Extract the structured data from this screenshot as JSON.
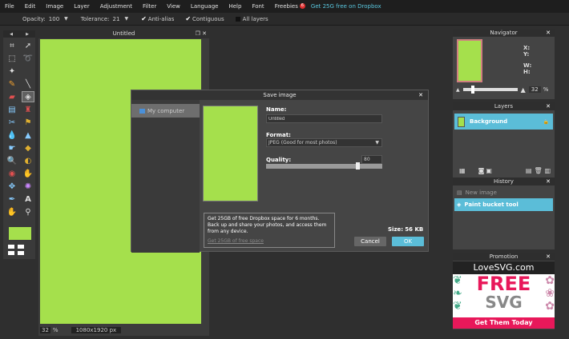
{
  "menu": {
    "items": [
      "File",
      "Edit",
      "Image",
      "Layer",
      "Adjustment",
      "Filter",
      "View",
      "Language",
      "Help",
      "Font",
      "Freebies"
    ],
    "badge": "6",
    "dropbox_link": "Get 25G free on Dropbox"
  },
  "options": {
    "opacity_label": "Opacity:",
    "opacity_value": "100",
    "tolerance_label": "Tolerance:",
    "tolerance_value": "21",
    "antialias": "Anti-alias",
    "contiguous": "Contiguous",
    "all_layers": "All layers"
  },
  "document": {
    "title": "Untitled",
    "zoom": "32",
    "zoom_unit": "%",
    "dimensions": "1080x1920 px"
  },
  "dialog": {
    "title": "Save image",
    "sidebar_item": "My computer",
    "name_label": "Name:",
    "name_value": "Untitled",
    "format_label": "Format:",
    "format_value": "JPEG (Good for most photos)",
    "quality_label": "Quality:",
    "quality_value": "80",
    "quality_fraction": 0.8,
    "promo_text": "Get 25GB of free Dropbox space for 6 months. Back up and share your photos, and access them from any device.",
    "promo_link": "Get 25GB of free space",
    "size_label": "Size:",
    "size_value": "56 KB",
    "cancel_label": "Cancel",
    "ok_label": "OK"
  },
  "navigator": {
    "title": "Navigator",
    "x_label": "X:",
    "y_label": "Y:",
    "w_label": "W:",
    "h_label": "H:",
    "zoom": "32",
    "zoom_unit": "%"
  },
  "layers": {
    "title": "Layers",
    "layer_name": "Background"
  },
  "history": {
    "title": "History",
    "item1": "New image",
    "item2": "Paint bucket tool"
  },
  "promotion": {
    "title": "Promotion",
    "brand": "LoveSVG.com",
    "headline1": "FREE",
    "headline2": "SVG",
    "cta": "Get Them Today"
  },
  "colors": {
    "canvas": "#a5e04c",
    "accent": "#5bbdd8",
    "menubar": "#1e1e1e",
    "promo_pink": "#e8185a"
  }
}
